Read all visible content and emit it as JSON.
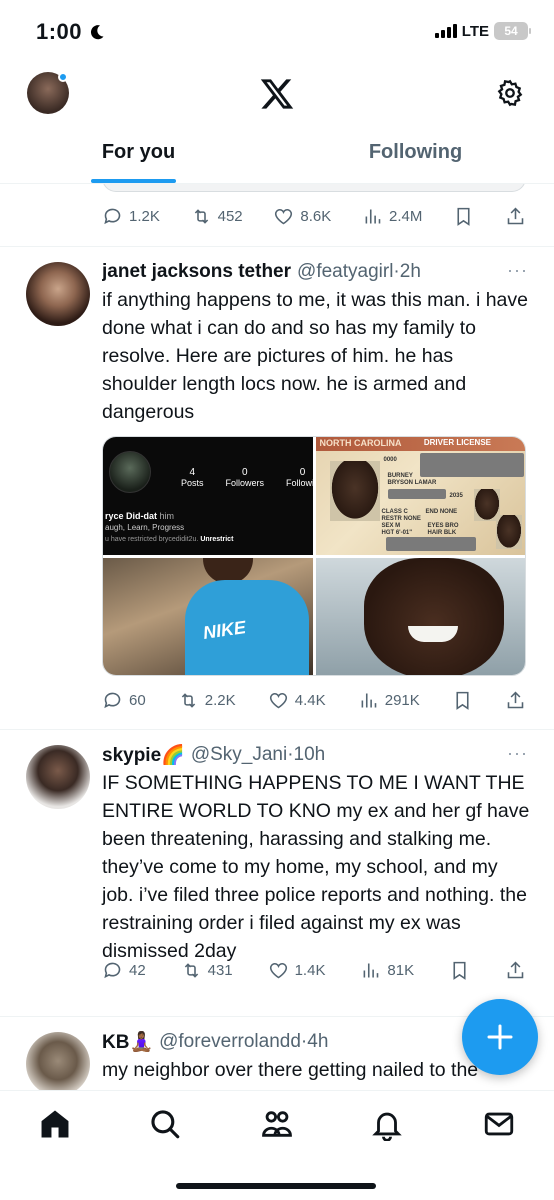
{
  "status_bar": {
    "time": "1:00",
    "network": "LTE",
    "battery": "54"
  },
  "header": {
    "tabs": [
      {
        "label": "For you",
        "active": true
      },
      {
        "label": "Following",
        "active": false
      }
    ]
  },
  "previous_tweet": {
    "replies": "1.2K",
    "reposts": "452",
    "likes": "8.6K",
    "views": "2.4M"
  },
  "tweets": [
    {
      "name": "janet jacksons tether",
      "handle": "@featyagirl",
      "time": "2h",
      "text": "if anything happens to me, it was this man. i have done what i can do and so has my family to resolve. Here are pictures of him. he has shoulder length locs now. he is armed and dangerous",
      "media": {
        "profile_shot": {
          "posts_count": "4",
          "posts_label": "Posts",
          "followers_count": "0",
          "followers_label": "Followers",
          "following_count": "0",
          "following_label": "Followin",
          "name_line": "ryce Did-dat",
          "name_suffix": "him",
          "bio": "augh, Learn, Progress",
          "restricted": "u have restricted brycedidit2u.",
          "unrestrict": "Unrestrict"
        },
        "license": {
          "state": "NORTH CAROLINA",
          "title": "DRIVER LICENSE",
          "line1": "BURNEY",
          "line2": "BRYSON LAMAR",
          "class": "CLASS C",
          "restr": "RESTR NONE",
          "end": "END NONE",
          "sex": "SEX M",
          "eyes": "EYES BRO",
          "hgt": "HGT 6'-01\"",
          "hair": "HAIR BLK",
          "num": "0000",
          "year": "2035"
        },
        "shirt_text": "NIKE"
      },
      "stats": {
        "replies": "60",
        "reposts": "2.2K",
        "likes": "4.4K",
        "views": "291K"
      }
    },
    {
      "name": "skypie🌈",
      "handle": "@Sky_Jani",
      "time": "10h",
      "text": "IF SOMETHING HAPPENS TO ME I WANT THE ENTIRE WORLD TO KNO my ex and her gf have been threatening, harassing and stalking me. they’ve come to my home, my school, and my job. i’ve filed three police reports and nothing. the restraining order i filed against my ex was dismissed 2day",
      "stats": {
        "replies": "42",
        "reposts": "431",
        "likes": "1.4K",
        "views": "81K"
      }
    },
    {
      "name": "KB🧘🏾‍♀️",
      "handle": "@foreverrolandd",
      "time": "4h",
      "text": "my neighbor over there getting nailed to the"
    }
  ],
  "colors": {
    "accent": "#1d9bf0",
    "text": "#0f1419",
    "muted": "#536471"
  }
}
